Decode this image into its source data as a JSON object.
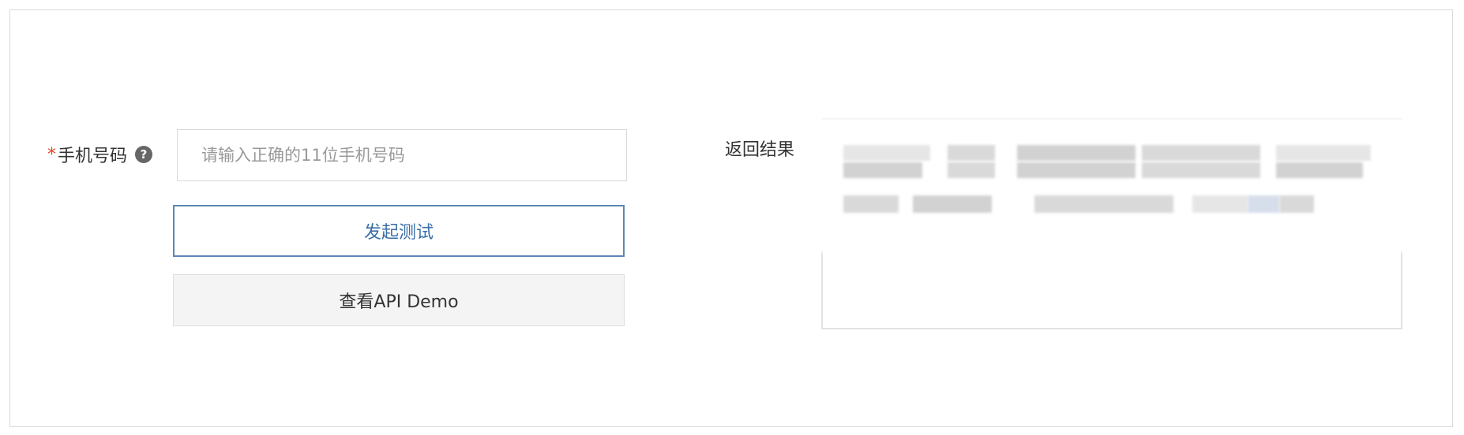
{
  "form": {
    "required_mark": "*",
    "phone_label": "手机号码",
    "help_glyph": "?",
    "phone_placeholder": "请输入正确的11位手机号码",
    "phone_value": ""
  },
  "actions": {
    "start_test_label": "发起测试",
    "view_demo_label": "查看API Demo"
  },
  "result": {
    "label": "返回结果",
    "content_obscured": true
  },
  "colors": {
    "required": "#e0452b",
    "primary_border": "#5d86b5",
    "primary_text": "#3a6ea8",
    "secondary_bg": "#f4f4f4"
  }
}
